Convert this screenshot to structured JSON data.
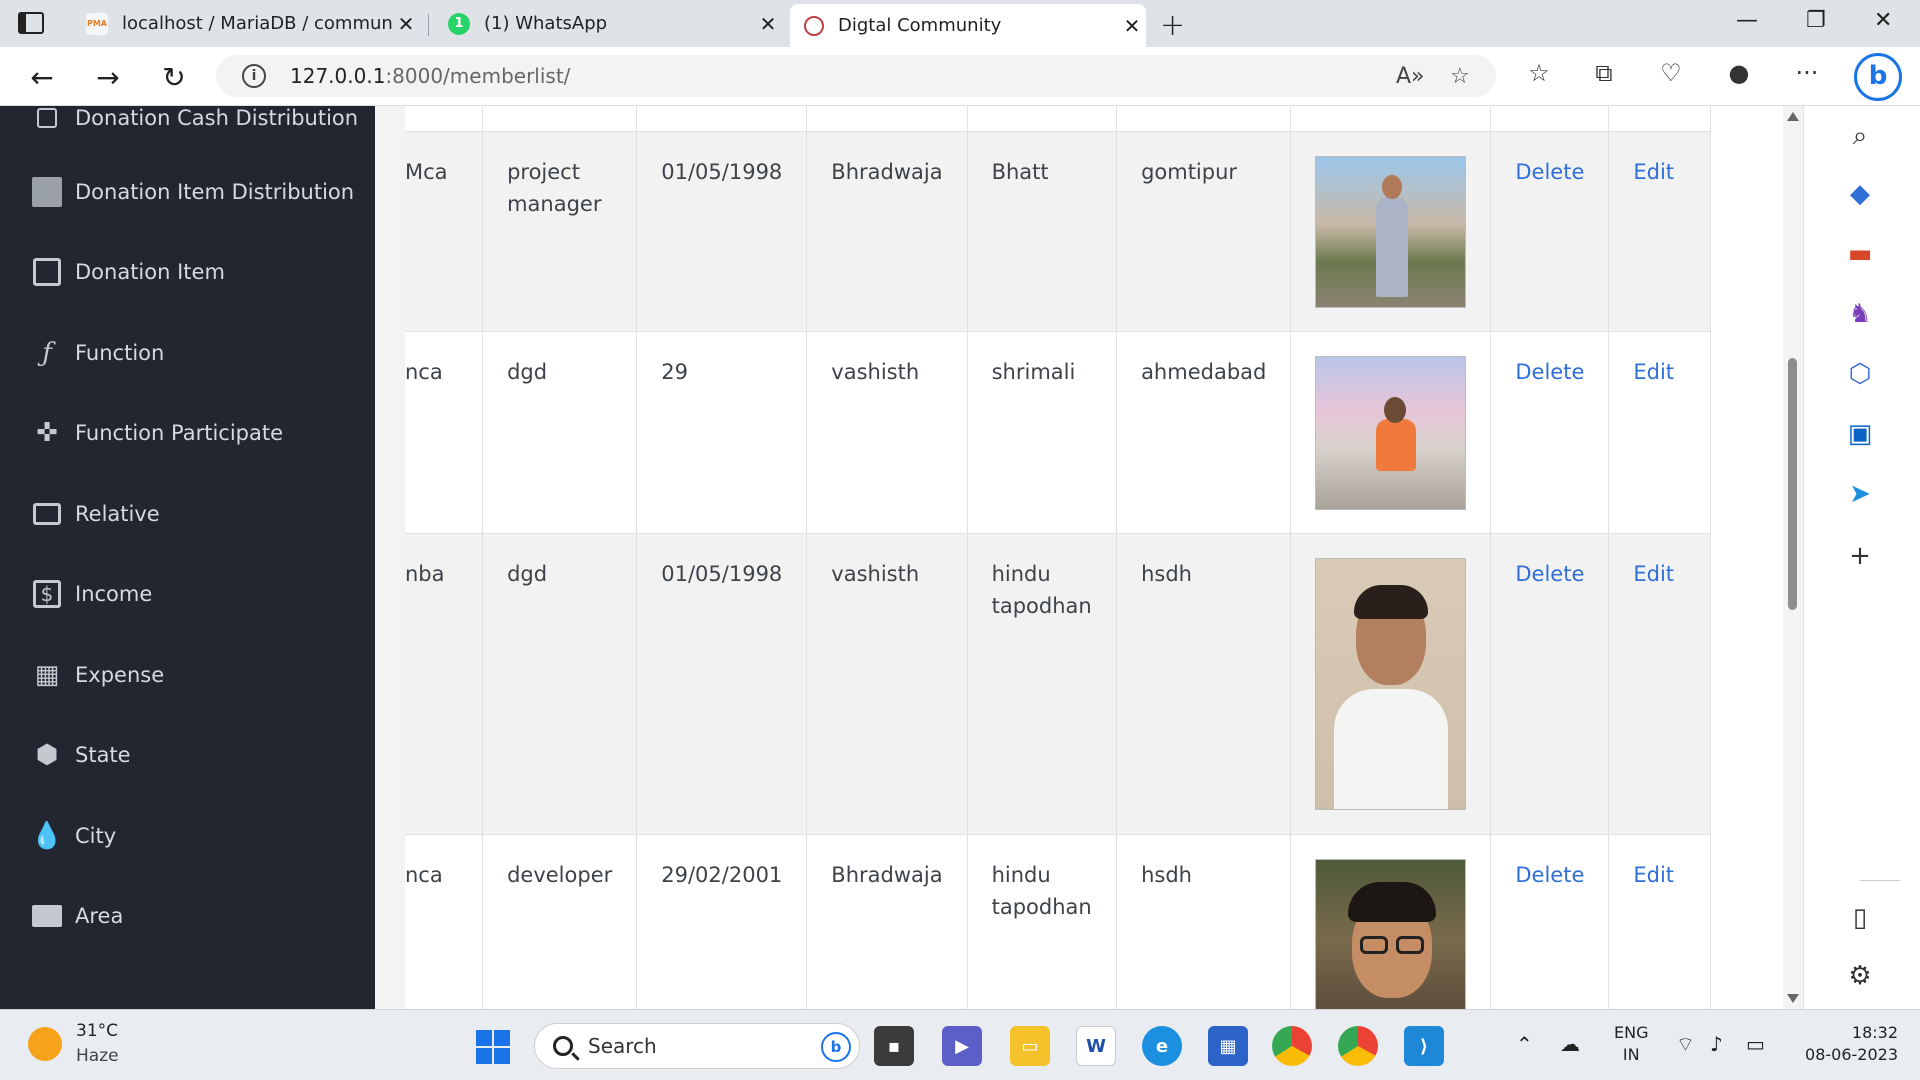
{
  "browser": {
    "tabs": [
      {
        "title": "localhost / MariaDB / community",
        "favicon": "phpmyadmin-icon",
        "favicon_text": "PMA"
      },
      {
        "title": "(1) WhatsApp",
        "favicon": "whatsapp-icon",
        "favicon_text": "1"
      },
      {
        "title": "Digtal Community",
        "favicon": "community-logo-icon",
        "favicon_text": "",
        "active": true
      }
    ],
    "url_host": "127.0.0.1",
    "url_rest": ":8000/memberlist/"
  },
  "sidebar": {
    "items": [
      {
        "label": "Donation Cash Distribution",
        "icon": "square-outline-icon"
      },
      {
        "label": "Donation Item Distribution",
        "icon": "square-filled-icon"
      },
      {
        "label": "Donation Item",
        "icon": "wallet-icon"
      },
      {
        "label": "Function",
        "icon": "function-icon"
      },
      {
        "label": "Function Participate",
        "icon": "gamepad-icon"
      },
      {
        "label": "Relative",
        "icon": "id-card-icon"
      },
      {
        "label": "Income",
        "icon": "dollar-icon"
      },
      {
        "label": "Expense",
        "icon": "grid-icon"
      },
      {
        "label": "State",
        "icon": "hexagon-icon"
      },
      {
        "label": "City",
        "icon": "drop-icon"
      },
      {
        "label": "Area",
        "icon": "image-icon"
      }
    ]
  },
  "table": {
    "rows": [
      {
        "education": "Mca",
        "occupation": "project manager",
        "dob": "01/05/1998",
        "gotra": "Bhradwaja",
        "caste": "Bhatt",
        "area": "gomtipur",
        "photo": "member-photo-1",
        "delete": "Delete",
        "edit": "Edit"
      },
      {
        "education": "nca",
        "occupation": "dgd",
        "dob": "29",
        "gotra": "vashisth",
        "caste": "shrimali",
        "area": "ahmedabad",
        "photo": "member-photo-2",
        "delete": "Delete",
        "edit": "Edit"
      },
      {
        "education": "nba",
        "occupation": "dgd",
        "dob": "01/05/1998",
        "gotra": "vashisth",
        "caste": "hindu tapodhan",
        "area": "hsdh",
        "photo": "member-photo-3",
        "delete": "Delete",
        "edit": "Edit"
      },
      {
        "education": "nca",
        "occupation": "developer",
        "dob": "29/02/2001",
        "gotra": "Bhradwaja",
        "caste": "hindu tapodhan",
        "area": "hsdh",
        "photo": "member-photo-4",
        "delete": "Delete",
        "edit": "Edit"
      }
    ]
  },
  "taskbar": {
    "weather_temp": "31°C",
    "weather_desc": "Haze",
    "search_placeholder": "Search",
    "lang_top": "ENG",
    "lang_bottom": "IN",
    "time": "18:32",
    "date": "08-06-2023"
  },
  "colors": {
    "sidebar_bg": "#212631",
    "link": "#2f6fd6",
    "row_stripe": "#f2f2f2"
  }
}
